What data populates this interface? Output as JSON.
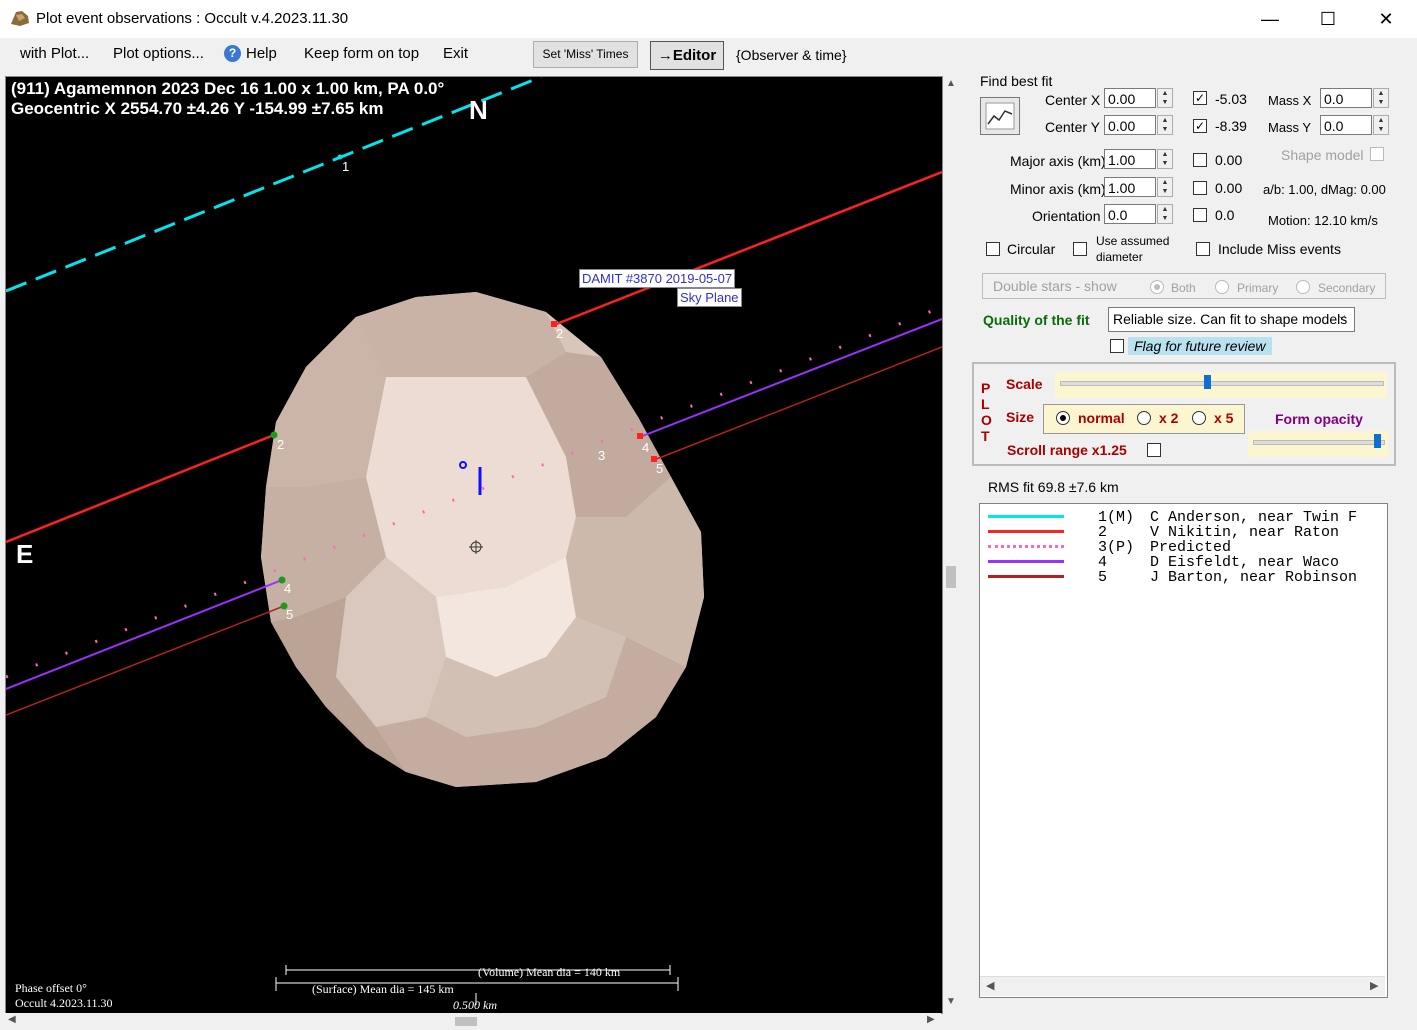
{
  "window": {
    "title": "Plot event observations : Occult v.4.2023.11.30",
    "minimize": "—",
    "maximize": "☐",
    "close": "✕"
  },
  "menu": {
    "items": [
      "with Plot...",
      "Plot options...",
      "Help",
      "Keep form on top",
      "Exit"
    ],
    "set_miss_times": "Set 'Miss' Times",
    "editor": "→Editor",
    "observer_time": "{Observer & time}"
  },
  "plot": {
    "header_line1": "(911) Agamemnon  2023 Dec 16   1.00 x 1.00 km, PA 0.0°",
    "header_line2": "Geocentric  X  2554.70 ±4.26  Y -154.99 ±7.65 km",
    "north": "N",
    "east": "E",
    "damit_label": "DAMIT #3870 2019-05-07",
    "sky_plane": "Sky Plane",
    "phase_offset": "Phase offset 0°",
    "version": "Occult 4.2023.11.30",
    "volume_dia": "(Volume) Mean dia = 140 km",
    "surface_dia": "(Surface) Mean dia = 145 km",
    "scale_bar": "0.500 km",
    "chord_labels": [
      "1",
      "2",
      "2",
      "3",
      "4",
      "5",
      "4",
      "5"
    ]
  },
  "fit": {
    "find_best_fit": "Find best fit",
    "center_x_label": "Center X",
    "center_x": "0.00",
    "center_y_label": "Center Y",
    "center_y": "0.00",
    "cx_result": "-5.03",
    "cy_result": "-8.39",
    "mass_x_label": "Mass X",
    "mass_x": "0.0",
    "mass_y_label": "Mass Y",
    "mass_y": "0.0",
    "major_label": "Major axis (km)",
    "major": "1.00",
    "major_result": "0.00",
    "minor_label": "Minor axis (km)",
    "minor": "1.00",
    "minor_result": "0.00",
    "orient_label": "Orientation",
    "orient": "0.0",
    "orient_result": "0.0",
    "shape_model": "Shape model",
    "ab_dmag": "a/b: 1.00, dMag: 0.00",
    "motion": "Motion: 12.10 km/s",
    "circular": "Circular",
    "use_assumed": "Use assumed",
    "diameter": "diameter",
    "include_miss": "Include Miss events",
    "double_stars": "Double stars - show",
    "both": "Both",
    "primary": "Primary",
    "secondary": "Secondary",
    "quality_label": "Quality of the fit",
    "quality_value": "Reliable size. Can fit to shape models",
    "flag_review": "Flag for future review"
  },
  "plotctl": {
    "vertical": [
      "P",
      "L",
      "O",
      "T"
    ],
    "scale": "Scale",
    "size": "Size",
    "normal": "normal",
    "x2": "x 2",
    "x5": "x 5",
    "form_opacity": "Form opacity",
    "scroll_range": "Scroll range x1.25"
  },
  "rms": "RMS fit 69.8 ±7.6 km",
  "legend": [
    {
      "num": "1(M)",
      "name": "C Anderson, near Twin F",
      "color": "#00e5ee",
      "style": "solid"
    },
    {
      "num": "2",
      "name": "V Nikitin, near Raton",
      "color": "#ff2020",
      "style": "solid"
    },
    {
      "num": "3(P)",
      "name": "Predicted",
      "color": "#ff69b4",
      "style": "dotted"
    },
    {
      "num": "4",
      "name": "D Eisfeldt, near Waco",
      "color": "#9b30ff",
      "style": "solid"
    },
    {
      "num": "5",
      "name": "J Barton, near Robinson",
      "color": "#b22222",
      "style": "solid"
    }
  ]
}
